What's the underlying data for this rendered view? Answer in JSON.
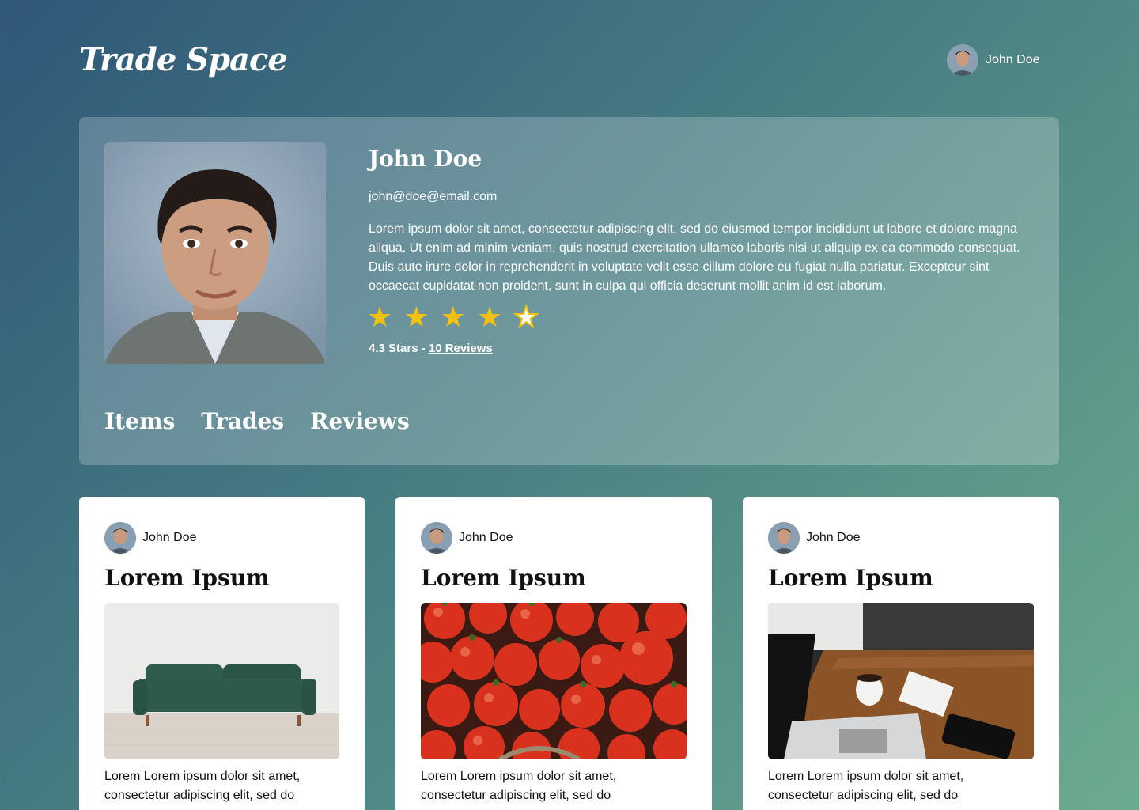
{
  "header": {
    "logo": "Trade Space",
    "user_name": "John Doe"
  },
  "profile": {
    "name": "John Doe",
    "email": "john@doe@email.com",
    "bio": "Lorem ipsum dolor sit amet, consectetur adipiscing elit, sed do eiusmod tempor incididunt ut labore et dolore magna aliqua. Ut enim ad minim veniam, quis nostrud exercitation ullamco laboris nisi ut aliquip ex ea commodo consequat. Duis aute irure dolor in reprehenderit in voluptate velit esse cillum dolore eu fugiat nulla pariatur. Excepteur sint occaecat cupidatat non proident, sunt in culpa qui officia deserunt mollit anim id est laborum.",
    "rating_value": 4.3,
    "rating_text": "4.3 Stars - ",
    "reviews_link": "10 Reviews",
    "star_glyph": "★"
  },
  "tabs": [
    {
      "label": "Items"
    },
    {
      "label": "Trades"
    },
    {
      "label": "Reviews"
    }
  ],
  "items": [
    {
      "author": "John Doe",
      "title": "Lorem Ipsum",
      "image": "sofa-photo",
      "description": "Lorem Lorem ipsum dolor sit amet, consectetur adipiscing elit, sed do"
    },
    {
      "author": "John Doe",
      "title": "Lorem Ipsum",
      "image": "tomatoes-photo",
      "description": "Lorem Lorem ipsum dolor sit amet, consectetur adipiscing elit, sed do"
    },
    {
      "author": "John Doe",
      "title": "Lorem Ipsum",
      "image": "laptop-desk-photo",
      "description": "Lorem Lorem ipsum dolor sit amet, consectetur adipiscing elit, sed do"
    }
  ],
  "colors": {
    "star": "#f2c10f",
    "card_bg": "#ffffff"
  }
}
